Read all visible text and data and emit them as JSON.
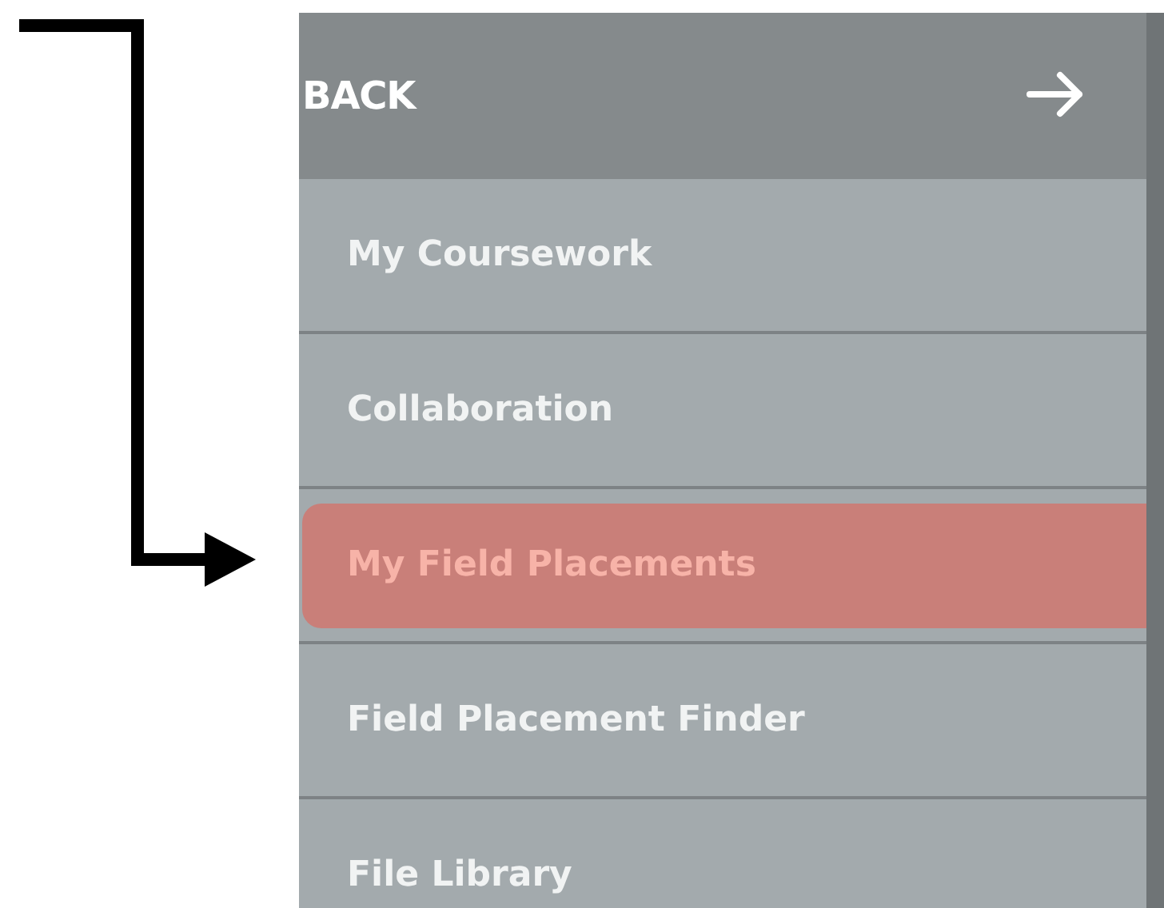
{
  "menu": {
    "back_label": "BACK",
    "items": [
      {
        "label": "My Coursework",
        "selected": false
      },
      {
        "label": "Collaboration",
        "selected": false
      },
      {
        "label": "My Field Placements",
        "selected": true
      },
      {
        "label": "Field Placement Finder",
        "selected": false
      },
      {
        "label": "File Library",
        "selected": false
      }
    ]
  }
}
